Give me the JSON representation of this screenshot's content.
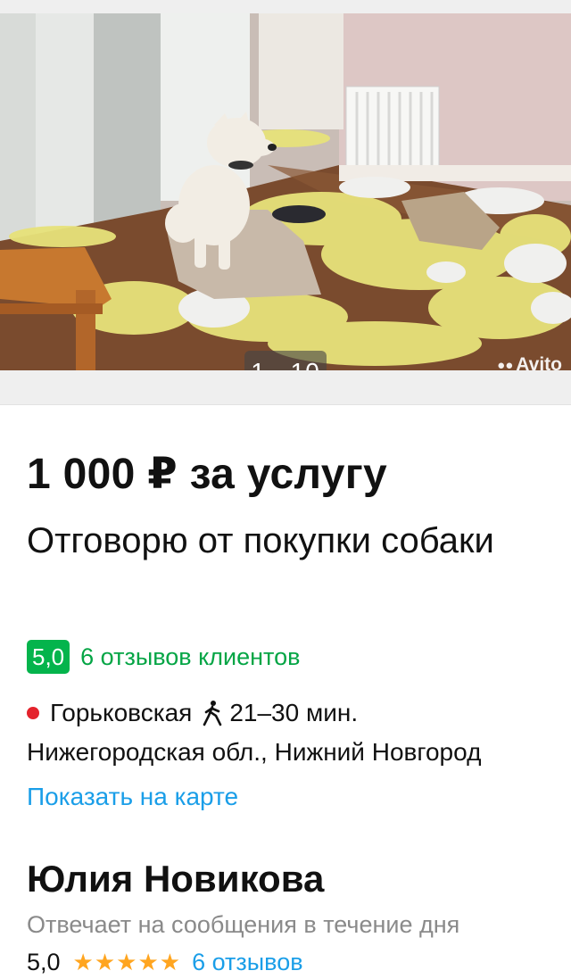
{
  "gallery": {
    "counter": "1 - 10",
    "watermark": "Avito"
  },
  "listing": {
    "price": "1 000 ₽ за услугу",
    "title": "Отговорю от покупки собаки",
    "rating_score": "5,0",
    "reviews_text": "6 отзывов клиентов"
  },
  "location": {
    "metro": "Горьковская",
    "walk_time": "21–30 мин.",
    "address": "Нижегородская обл., Нижний Новгород",
    "map_link": "Показать на карте"
  },
  "seller": {
    "name": "Юлия Новикова",
    "response": "Отвечает на сообщения в течение дня",
    "rating": "5,0",
    "stars": "★★★★★",
    "reviews": "6 отзывов"
  },
  "colors": {
    "accent_green": "#04b44c",
    "link_blue": "#1a9ee8",
    "metro_red": "#e4232c",
    "star_orange": "#ffa520"
  }
}
